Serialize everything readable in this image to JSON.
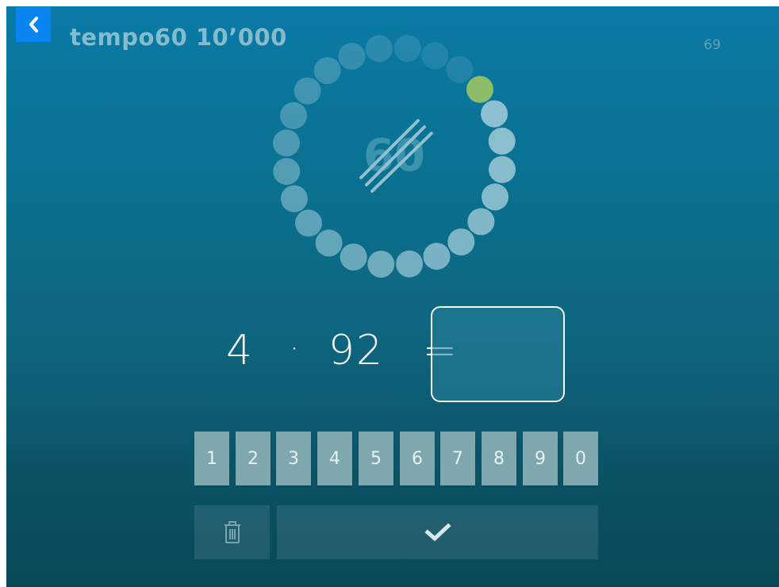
{
  "header": {
    "title": "tempo60 10’000",
    "count": "69",
    "back_icon": "chevron-left-icon"
  },
  "dial": {
    "center_label": "60",
    "total_dots": 24,
    "elapsed_dots": 1,
    "current_dot": 1,
    "colors": {
      "active_dot": "#8fc1d0",
      "current_dot": "#8dbd6a",
      "faded_dot": "#2f8aa3"
    }
  },
  "problem": {
    "a": "4",
    "operator": "·",
    "b": "92",
    "equals": "=",
    "answer": ""
  },
  "keypad": {
    "keys": [
      "1",
      "2",
      "3",
      "4",
      "5",
      "6",
      "7",
      "8",
      "9",
      "0"
    ]
  },
  "actions": {
    "delete_icon": "trash-icon",
    "confirm_icon": "checkmark-icon"
  },
  "colors": {
    "back_button": "#0a84f0",
    "key": "#7ea8ad",
    "background_top": "#0a7aa6",
    "background_bottom": "#094756"
  }
}
